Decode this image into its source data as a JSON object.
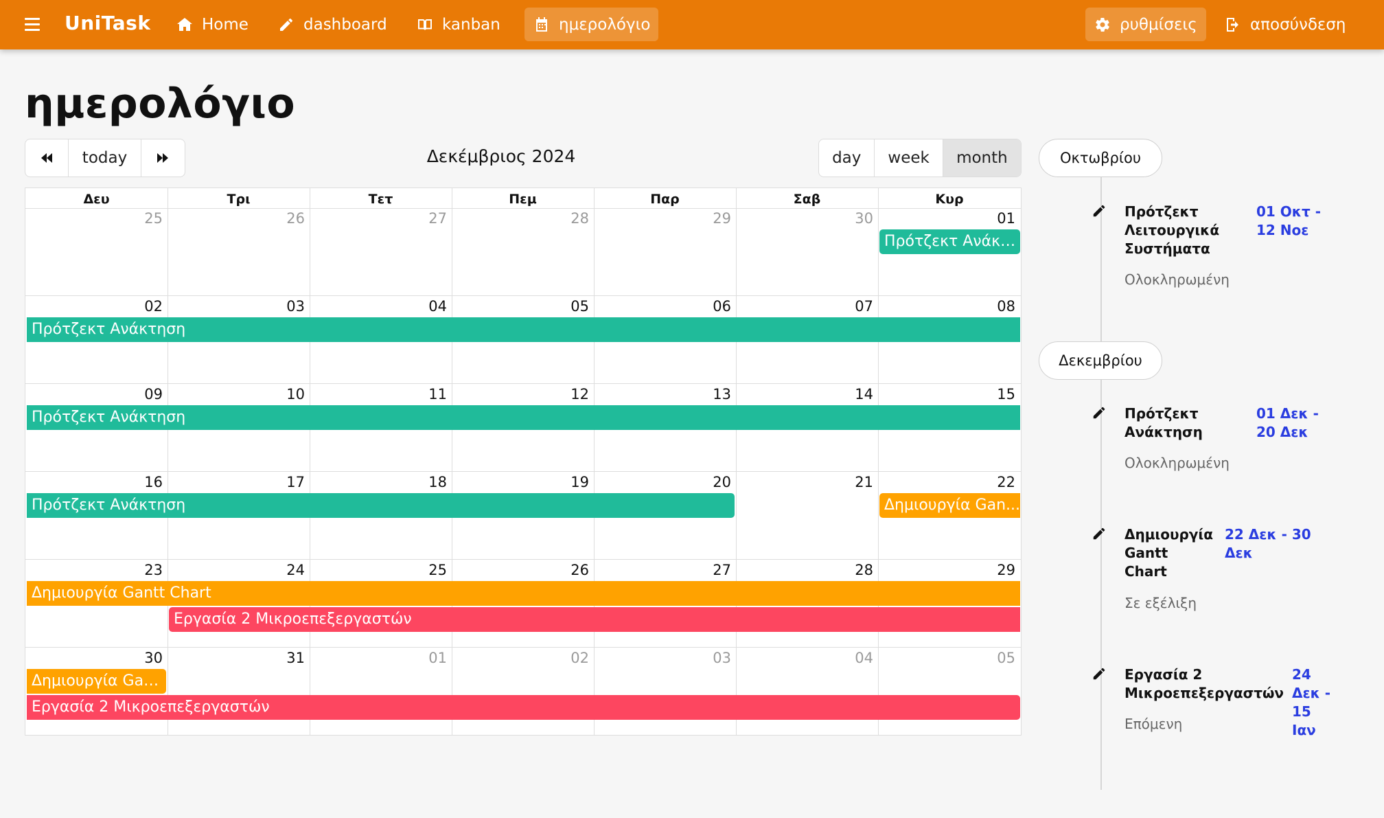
{
  "navbar": {
    "brand": "UniTask",
    "items": [
      {
        "label": "Home",
        "icon": "home-icon"
      },
      {
        "label": "dashboard",
        "icon": "pencil-icon"
      },
      {
        "label": "kanban",
        "icon": "book-icon"
      },
      {
        "label": "ημερολόγιο",
        "icon": "calendar-icon",
        "active": true
      }
    ],
    "right": [
      {
        "label": "ρυθμίσεις",
        "icon": "gear-icon"
      },
      {
        "label": "αποσύνδεση",
        "icon": "logout-icon"
      }
    ]
  },
  "page": {
    "title": "ημερολόγιο"
  },
  "toolbar": {
    "prev_icon": "double-chevron-left-icon",
    "today": "today",
    "next_icon": "double-chevron-right-icon",
    "title": "Δεκέμβριος 2024",
    "views": [
      "day",
      "week",
      "month"
    ],
    "selected_view": "month"
  },
  "calendar": {
    "weekdays": [
      "Δευ",
      "Τρι",
      "Τετ",
      "Πεμ",
      "Παρ",
      "Σαβ",
      "Κυρ"
    ],
    "weeks": [
      [
        "25",
        "26",
        "27",
        "28",
        "29",
        "30",
        "01"
      ],
      [
        "02",
        "03",
        "04",
        "05",
        "06",
        "07",
        "08"
      ],
      [
        "09",
        "10",
        "11",
        "12",
        "13",
        "14",
        "15"
      ],
      [
        "16",
        "17",
        "18",
        "19",
        "20",
        "21",
        "22"
      ],
      [
        "23",
        "24",
        "25",
        "26",
        "27",
        "28",
        "29"
      ],
      [
        "30",
        "31",
        "01",
        "02",
        "03",
        "04",
        "05"
      ]
    ],
    "events": [
      {
        "label": "Πρότζεκτ Ανάκτ...",
        "color": "teal"
      },
      {
        "label": "Πρότζεκτ Ανάκτηση",
        "color": "teal"
      },
      {
        "label": "Πρότζεκτ Ανάκτηση",
        "color": "teal"
      },
      {
        "label": "Πρότζεκτ Ανάκτηση",
        "color": "teal"
      },
      {
        "label": "Δημιουργία Gan...",
        "color": "orange"
      },
      {
        "label": "Δημιουργία Gantt Chart",
        "color": "orange"
      },
      {
        "label": "Εργασία 2 Μικροεπεξεργαστών",
        "color": "red"
      },
      {
        "label": "Δημιουργία Gan...",
        "color": "orange"
      },
      {
        "label": "Εργασία 2 Μικροεπεξεργαστών",
        "color": "red"
      }
    ],
    "colors": {
      "teal": "#20bb9a",
      "orange": "#ffa200",
      "red": "#fd4660"
    }
  },
  "timeline": {
    "months": [
      "Οκτωβρίου",
      "Δεκεμβρίου"
    ],
    "items": [
      {
        "title": "Πρότζεκτ Λειτουργικά Συστήματα",
        "date": "01 Οκτ - 12 Νοε",
        "status": "Ολοκληρωμένη"
      },
      {
        "title": "Πρότζεκτ Ανάκτηση",
        "date": "01 Δεκ - 20 Δεκ",
        "status": "Ολοκληρωμένη"
      },
      {
        "title": "Δημιουργία Gantt Chart",
        "date": "22 Δεκ - 30 Δεκ",
        "status": "Σε εξέλιξη"
      },
      {
        "title": "Εργασία 2 Μικροεπεξεργαστών",
        "date": "24 Δεκ - 15 Ιαν",
        "status": "Επόμενη"
      }
    ]
  }
}
